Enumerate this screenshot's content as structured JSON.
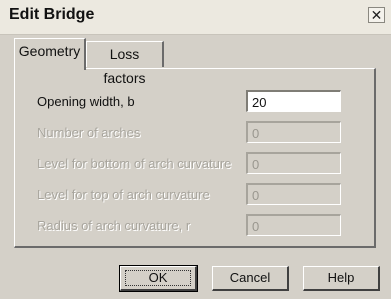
{
  "window": {
    "title": "Edit Bridge",
    "close_glyph": "✕"
  },
  "tabs": [
    {
      "label": "Geometry",
      "active": true
    },
    {
      "label": "Loss factors",
      "active": false
    }
  ],
  "fields": [
    {
      "label": "Opening width, b",
      "value": "20",
      "enabled": true
    },
    {
      "label": "Number of  arches",
      "value": "0",
      "enabled": false
    },
    {
      "label": "Level for bottom of arch curvature",
      "value": "0",
      "enabled": false
    },
    {
      "label": "Level for top of arch curvature",
      "value": "0",
      "enabled": false
    },
    {
      "label": "Radius of arch curvature, r",
      "value": "0",
      "enabled": false
    }
  ],
  "buttons": {
    "ok": "OK",
    "cancel": "Cancel",
    "help": "Help"
  }
}
